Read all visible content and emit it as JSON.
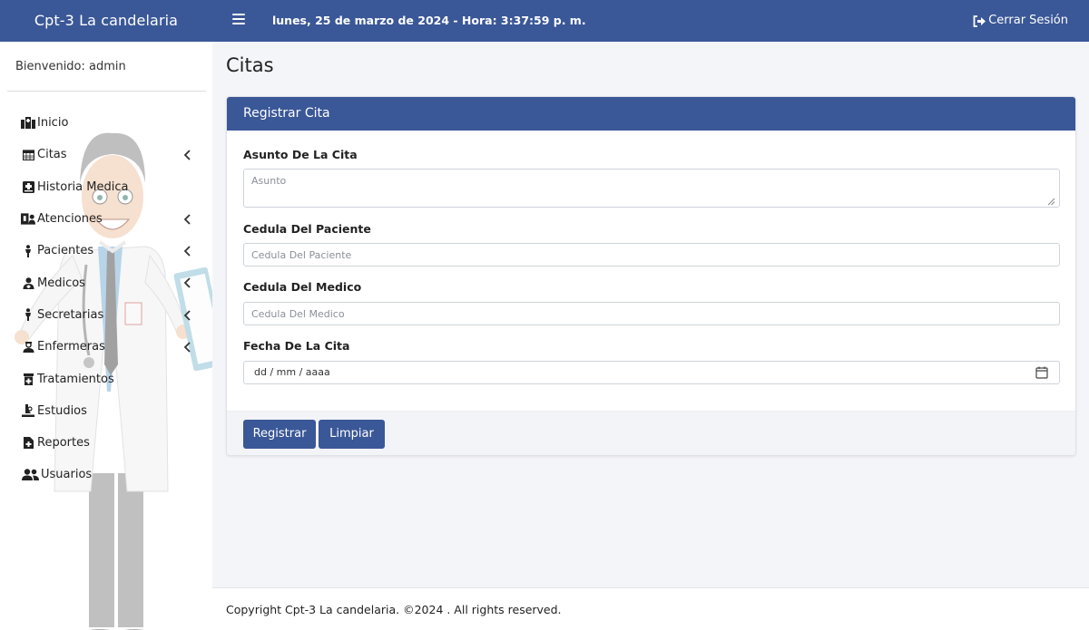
{
  "topbar": {
    "brand": "Cpt-3 La candelaria",
    "datetime": "lunes, 25 de marzo de 2024 - Hora: 3:37:59 p. m.",
    "logout_label": "Cerrar Sesión"
  },
  "sidebar": {
    "welcome": "Bienvenido: admin",
    "items": [
      {
        "label": "Inicio",
        "icon": "hospital-icon",
        "has_submenu": false
      },
      {
        "label": "Citas",
        "icon": "calendar-icon",
        "has_submenu": true
      },
      {
        "label": "Historia Medica",
        "icon": "medical-file-icon",
        "has_submenu": false
      },
      {
        "label": "Atenciones",
        "icon": "patient-bed-icon",
        "has_submenu": true
      },
      {
        "label": "Pacientes",
        "icon": "person-icon",
        "has_submenu": true
      },
      {
        "label": "Medicos",
        "icon": "doctor-icon",
        "has_submenu": true
      },
      {
        "label": "Secretarias",
        "icon": "person-icon",
        "has_submenu": true
      },
      {
        "label": "Enfermeras",
        "icon": "nurse-icon",
        "has_submenu": true
      },
      {
        "label": "Tratamientos",
        "icon": "prescription-bottle-icon",
        "has_submenu": false
      },
      {
        "label": "Estudios",
        "icon": "lab-icon",
        "has_submenu": false
      },
      {
        "label": "Reportes",
        "icon": "report-file-icon",
        "has_submenu": false
      },
      {
        "label": "Usuarios",
        "icon": "users-icon",
        "has_submenu": false
      }
    ]
  },
  "main": {
    "page_title": "Citas",
    "card_title": "Registrar Cita",
    "fields": {
      "subject_label": "Asunto De La Cita",
      "subject_placeholder": "Asunto",
      "patient_id_label": "Cedula Del Paciente",
      "patient_id_placeholder": "Cedula Del Paciente",
      "doctor_id_label": "Cedula Del Medico",
      "doctor_id_placeholder": "Cedula Del Medico",
      "date_label": "Fecha De La Cita",
      "date_placeholder": "dd / mm / aaaa"
    },
    "buttons": {
      "register": "Registrar",
      "clear": "Limpiar"
    }
  },
  "footer": {
    "copyright": "Copyright Cpt-3 La candelaria. ©2024 . All rights reserved."
  },
  "colors": {
    "primary": "#3a5797",
    "background": "#f4f5f9"
  }
}
